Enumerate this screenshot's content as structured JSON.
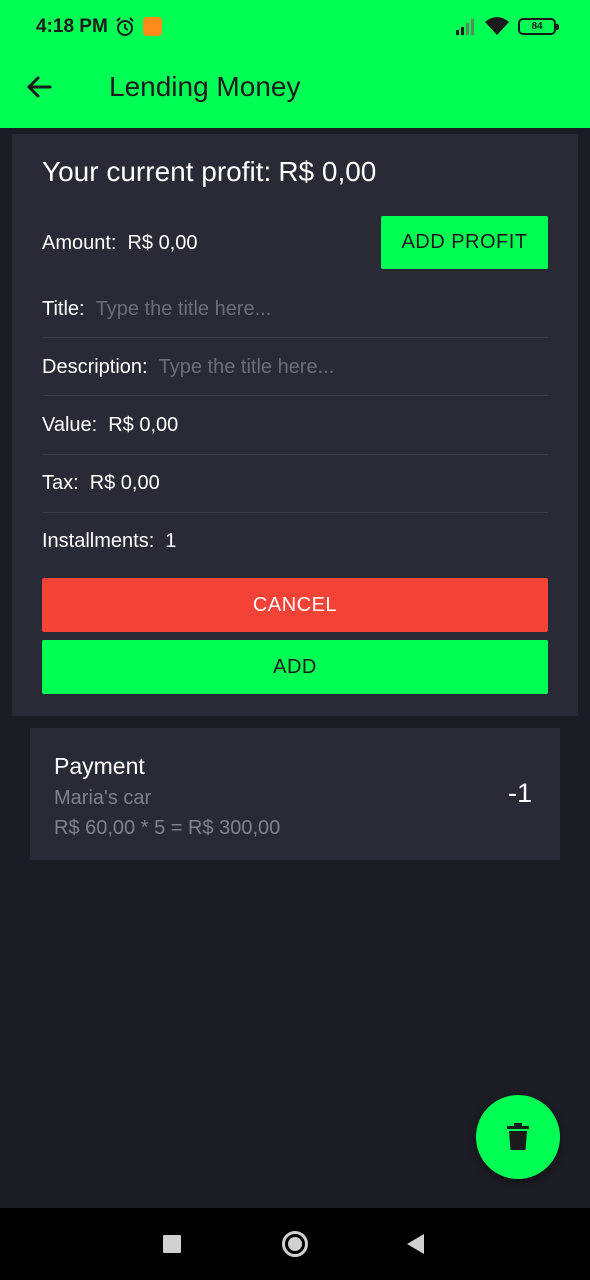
{
  "status_bar": {
    "time": "4:18 PM",
    "battery": "84",
    "icons": [
      "alarm-icon",
      "notification-icon",
      "signal-icon",
      "wifi-icon",
      "battery-icon"
    ]
  },
  "app_bar": {
    "title": "Lending Money",
    "back_icon": "arrow-left-icon"
  },
  "form": {
    "profit_label": "Your current profit:",
    "profit_value": "R$ 0,00",
    "amount_label": "Amount:",
    "amount_value": "R$ 0,00",
    "add_profit_label": "ADD PROFIT",
    "title_label": "Title:",
    "title_placeholder": "Type the title here...",
    "description_label": "Description:",
    "description_placeholder": "Type the title here...",
    "value_label": "Value:",
    "value_value": "R$ 0,00",
    "tax_label": "Tax:",
    "tax_value": "R$ 0,00",
    "installments_label": "Installments:",
    "installments_value": "1",
    "cancel_label": "CANCEL",
    "add_label": "ADD"
  },
  "list": {
    "items": [
      {
        "title": "Payment",
        "description": "Maria's car",
        "calculation": "R$ 60,00 * 5 = R$ 300,00",
        "count": "-1"
      }
    ]
  },
  "fab": {
    "icon": "trash-icon"
  },
  "colors": {
    "accent": "#00ff55",
    "background": "#1b1d24",
    "card": "#282a35",
    "danger": "#f44336"
  }
}
